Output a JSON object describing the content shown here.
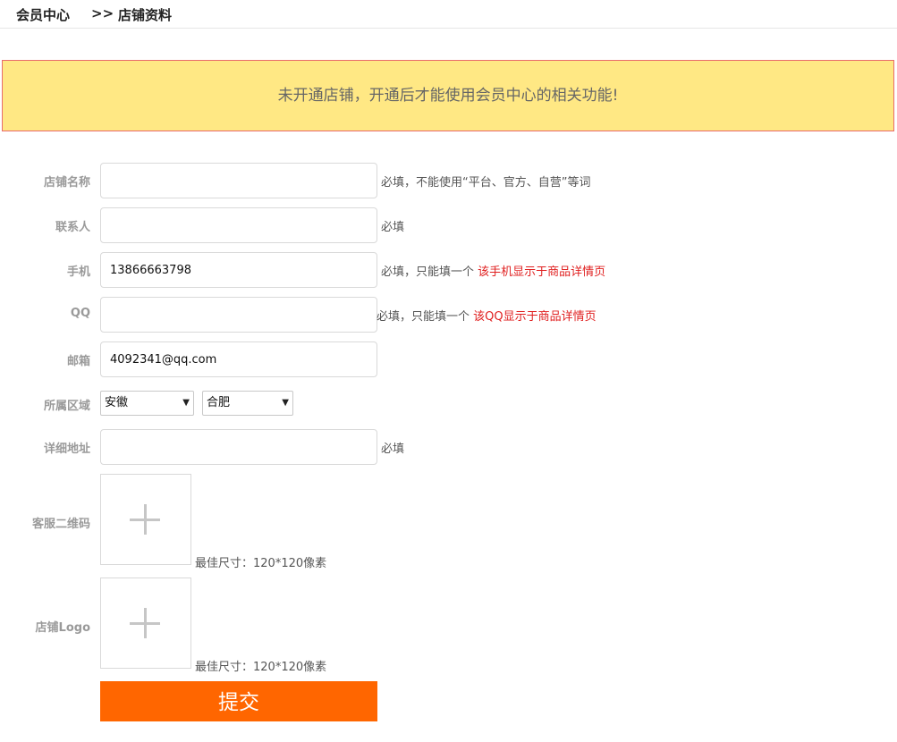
{
  "breadcrumb": {
    "home": "会员中心",
    "separator": ">>",
    "current": "店铺资料"
  },
  "notice": {
    "text": "未开通店铺，开通后才能使用会员中心的相关功能!"
  },
  "form": {
    "shop_name": {
      "label": "店铺名称",
      "value": "",
      "hint": "必填，不能使用“平台、官方、自营”等词"
    },
    "contact": {
      "label": "联系人",
      "value": "",
      "hint": "必填"
    },
    "phone": {
      "label": "手机",
      "value": "13866663798",
      "hint": "必填，只能填一个",
      "hint_red": "该手机显示于商品详情页"
    },
    "qq": {
      "label": "QQ",
      "value": "",
      "hint": "必填，只能填一个",
      "hint_red": "该QQ显示于商品详情页"
    },
    "email": {
      "label": "邮箱",
      "value": "4092341@qq.com"
    },
    "region": {
      "label": "所属区域",
      "province": "安徽",
      "city": "合肥"
    },
    "address": {
      "label": "详细地址",
      "value": "",
      "hint": "必填"
    },
    "qrcode": {
      "label": "客服二维码",
      "hint": "最佳尺寸：120*120像素"
    },
    "logo": {
      "label": "店铺Logo",
      "hint": "最佳尺寸：120*120像素"
    },
    "submit_label": "提交"
  },
  "colors": {
    "accent": "#ff6600",
    "notice_bg": "#ffe884",
    "notice_border": "#e86b6b",
    "hint_red": "#e02020"
  },
  "icons": {
    "upload": "plus-icon",
    "select": "chevron-down-icon"
  }
}
